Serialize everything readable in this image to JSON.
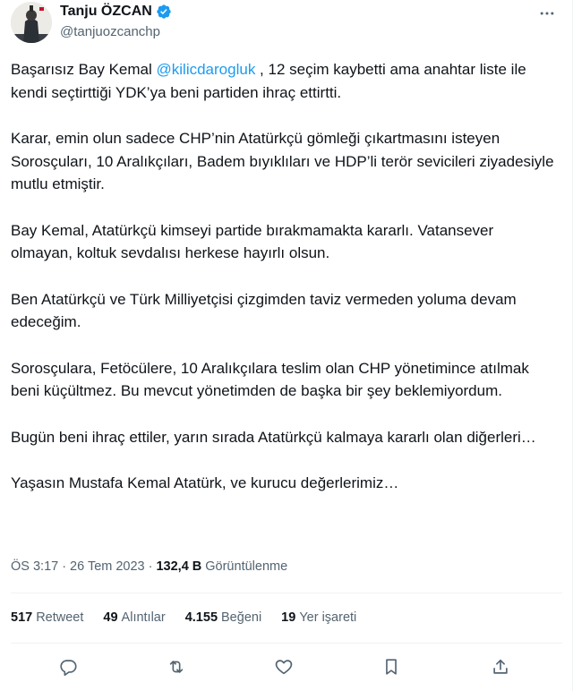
{
  "author": {
    "name": "Tanju ÖZCAN",
    "handle": "@tanjuozcanchp",
    "avatar_icon": "profile-photo",
    "verified_color": "#1d9bf0"
  },
  "tweet": {
    "p1_a": "Başarısız Bay Kemal ",
    "p1_mention": "@kilicdarogluk",
    "p1_b": " , 12 seçim kaybetti ama anahtar liste ile kendi seçtirttiği YDK’ya beni partiden ihraç ettirtti.",
    "p2": "Karar, emin olun sadece CHP’nin Atatürkçü gömleği çıkartmasını isteyen Sorosçuları, 10 Aralıkçıları, Badem bıyıklıları ve HDP’li terör sevicileri ziyadesiyle mutlu etmiştir.",
    "p3": "Bay Kemal, Atatürkçü kimseyi partide bırakmamakta kararlı. Vatansever olmayan, koltuk sevdalısı herkese hayırlı olsun.",
    "p4": "Ben Atatürkçü ve Türk Milliyetçisi çizgimden taviz vermeden yoluma devam edeceğim.",
    "p5": "Sorosçulara, Fetöcülere, 10 Aralıkçılara teslim olan CHP yönetimince atılmak beni küçültmez. Bu mevcut yönetimden de başka bir şey beklemiyordum.",
    "p6": "Bugün beni ihraç ettiler, yarın sırada Atatürkçü kalmaya kararlı olan diğerleri…",
    "p7": "Yaşasın Mustafa Kemal Atatürk, ve kurucu değerlerimiz…"
  },
  "meta": {
    "time": "ÖS 3:17",
    "sep": "·",
    "date": "26 Tem 2023",
    "views": "132,4 B",
    "views_label": "Görüntülenme"
  },
  "stats": {
    "retweets": "517",
    "retweets_label": "Retweet",
    "quotes": "49",
    "quotes_label": "Alıntılar",
    "likes": "4.155",
    "likes_label": "Beğeni",
    "bookmarks": "19",
    "bookmarks_label": "Yer işareti"
  },
  "icons": {
    "more": "more-icon",
    "reply": "reply-icon",
    "retweet": "retweet-icon",
    "like": "heart-icon",
    "bookmark": "bookmark-icon",
    "share": "share-icon",
    "icon_color": "#536471"
  }
}
